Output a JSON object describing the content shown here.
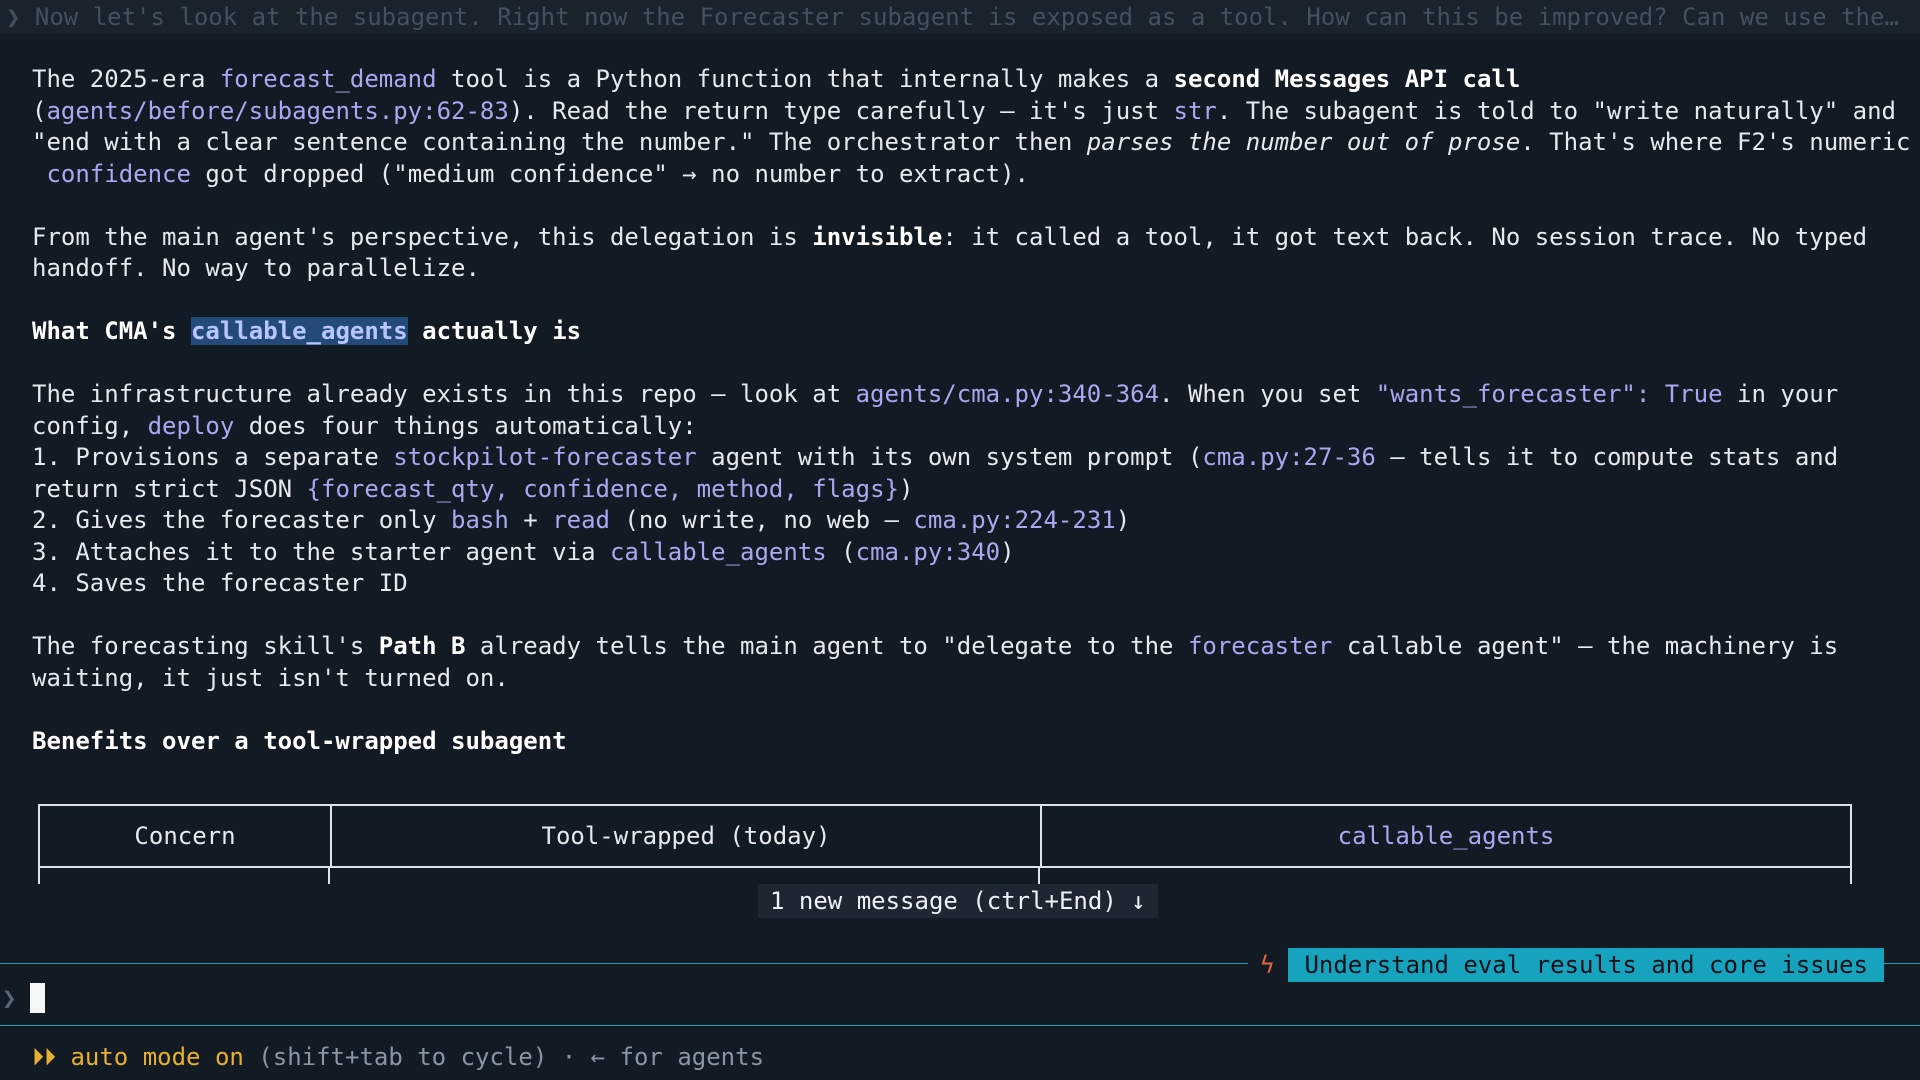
{
  "prompt_line": "❯ Now let's look at the subagent. Right now the Forecaster subagent is exposed as a tool. How can this be improved? Can we use the…",
  "para1": {
    "l1_a": "The 2025-era ",
    "l1_code": "forecast_demand",
    "l1_b": " tool is a Python function that internally makes a ",
    "l1_bold": "second Messages API call",
    "l2_a": "(",
    "l2_code": "agents/before/subagents.py:62-83",
    "l2_b": "). Read the return type carefully — it's just ",
    "l2_code2": "str",
    "l2_c": ". The subagent is told to \"write naturally\" and",
    "l3_a": "\"end with a clear sentence containing the number.\" The orchestrator then ",
    "l3_italic": "parses the number out of prose",
    "l3_b": ". That's where F2's numeric",
    "l4_code": "confidence",
    "l4_a": " got dropped (\"medium confidence\" → no number to extract)."
  },
  "para2": {
    "l1_a": "From the main agent's perspective, this delegation is ",
    "l1_bold": "invisible",
    "l1_b": ": it called a tool, it got text back. No session trace. No typed",
    "l2": "handoff. No way to parallelize."
  },
  "heading1": {
    "a": "What CMA's ",
    "code": "callable_agents",
    "b": " actually is"
  },
  "para3": {
    "l1_a": "The infrastructure already exists in this repo — look at ",
    "l1_code": "agents/cma.py:340-364",
    "l1_b": ". When you set ",
    "l1_code2": "\"wants_forecaster\": True",
    "l1_c": " in your",
    "l2_a": "config, ",
    "l2_code": "deploy",
    "l2_b": " does four things automatically:"
  },
  "list": {
    "i1_a": "1. Provisions a separate ",
    "i1_code": "stockpilot-forecaster",
    "i1_b": " agent with its own system prompt (",
    "i1_code2": "cma.py:27-36",
    "i1_c": " — tells it to compute stats and",
    "i1_l2_a": "return strict JSON ",
    "i1_l2_code": "{forecast_qty, confidence, method, flags}",
    "i1_l2_b": ")",
    "i2_a": "2. Gives the forecaster only ",
    "i2_code": "bash",
    "i2_b": " + ",
    "i2_code2": "read",
    "i2_c": " (no write, no web — ",
    "i2_code3": "cma.py:224-231",
    "i2_d": ")",
    "i3_a": "3. Attaches it to the starter agent via ",
    "i3_code": "callable_agents",
    "i3_b": " (",
    "i3_code2": "cma.py:340",
    "i3_c": ")",
    "i4": "4. Saves the forecaster ID"
  },
  "para4": {
    "l1_a": "The forecasting skill's ",
    "l1_bold": "Path B",
    "l1_b": " already tells the main agent to \"delegate to the ",
    "l1_code": "forecaster",
    "l1_c": " callable agent\" — the machinery is",
    "l2": "waiting, it just isn't turned on."
  },
  "heading2": "Benefits over a tool-wrapped subagent",
  "table": {
    "headers": [
      "Concern",
      "Tool-wrapped (today)",
      "callable_agents"
    ]
  },
  "new_message": "1 new message (ctrl+End) ↓",
  "task_badge": "Understand eval results and core issues",
  "input_chevron": "❯",
  "mode": {
    "arrows": "⏵⏵",
    "label": "auto mode on",
    "hint": " (shift+tab to cycle) · ← for agents"
  },
  "colors": {
    "background": "#121a24",
    "code": "#a9a8f0",
    "accent_teal": "#17a3bd",
    "mode_yellow": "#e8b030",
    "bolt_orange": "#e0683a"
  }
}
